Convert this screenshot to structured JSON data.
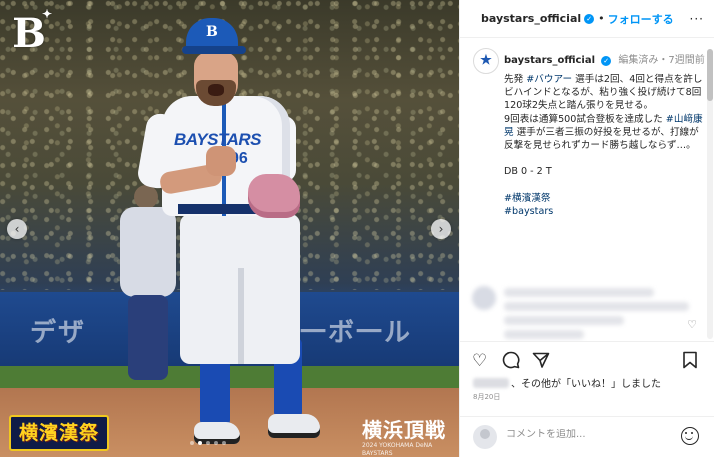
{
  "post": {
    "username": "baystars_official",
    "header_separator": "•",
    "follow_label": "フォローする",
    "more_icon": "more-horizontal-icon",
    "caption": {
      "username": "baystars_official",
      "edited_label": "編集済み",
      "separator": "・",
      "time_ago": "7週間前",
      "body_intro": "先発 ",
      "tag_bauer": "#バウアー",
      "body_a": " 選手は2回、4回と得点を許しビハインドとなるが、粘り強く投げ続けて8回120球2失点と踏ん張りを見せる。\n9回表は通算500試合登板を達成した ",
      "tag_yamasaki": "#山﨑康晃",
      "body_b": " 選手が三者三振の好投を見せるが、打線が反撃を見せられずカード勝ち越しならず…。\n\nDB 0 - 2 T\n\n",
      "tag_festival": "#横濱漢祭",
      "tag_baystars": "#baystars"
    },
    "likes_text": "、その他が「いいね！」しました",
    "date": "8月20日",
    "comment_placeholder": "コメントを追加..."
  },
  "photo": {
    "team_logo": "B",
    "jersey_text": "BAYSTARS",
    "jersey_number": "96",
    "cap_logo": "B",
    "wall_text_left": "デザ",
    "wall_text_right": "一ボ一ル",
    "badge_left": "横濱漢祭",
    "badge_right": "横浜頂戦",
    "badge_right_sub": "2024 YOKOHAMA DeNA BAYSTARS",
    "nav_prev": "‹",
    "nav_next": "›",
    "slide_count": 5,
    "slide_active": 2
  },
  "icons": {
    "like": "heart-icon",
    "comment": "comment-icon",
    "share": "send-icon",
    "save": "bookmark-icon",
    "emoji": "emoji-icon",
    "verified": "verified-badge-icon"
  },
  "colors": {
    "accent": "#0095f6",
    "hashtag": "#00376b",
    "team_blue": "#1c5ab8"
  }
}
